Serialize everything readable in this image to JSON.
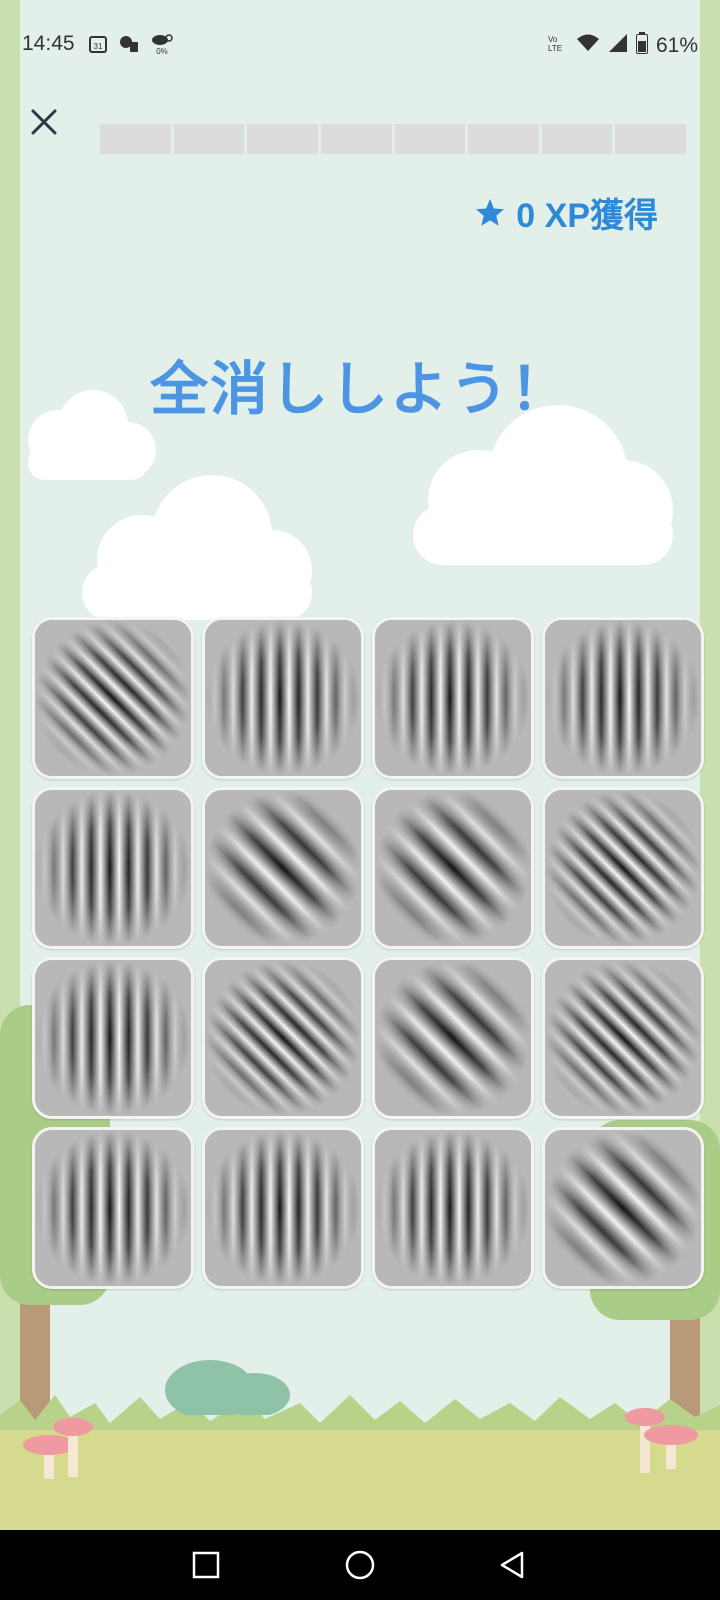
{
  "status_bar": {
    "time": "14:45",
    "battery_text": "61%",
    "left_icons": [
      "calendar-icon",
      "lock-icon",
      "weather-icon"
    ],
    "right_icons": [
      "volte-icon",
      "wifi-icon",
      "signal-icon",
      "battery-icon"
    ],
    "weather_percent": "0%",
    "calendar_day": "31",
    "volte_top": "Vo",
    "volte_bottom": "LTE"
  },
  "header": {
    "close_icon": "close-icon",
    "progress_segments": 8,
    "progress_filled": 0,
    "xp_value": "0 XP獲得",
    "xp_icon": "star-icon"
  },
  "title": "全消ししよう！",
  "grid": {
    "columns": 4,
    "rows": 4,
    "cards": [
      {
        "pattern": "diagonal-fine"
      },
      {
        "pattern": "vertical"
      },
      {
        "pattern": "vertical"
      },
      {
        "pattern": "vertical"
      },
      {
        "pattern": "vertical"
      },
      {
        "pattern": "diagonal-coarse"
      },
      {
        "pattern": "diagonal-coarse"
      },
      {
        "pattern": "diagonal-fine"
      },
      {
        "pattern": "vertical"
      },
      {
        "pattern": "diagonal-fine"
      },
      {
        "pattern": "diagonal-coarse"
      },
      {
        "pattern": "diagonal-fine"
      },
      {
        "pattern": "vertical"
      },
      {
        "pattern": "vertical"
      },
      {
        "pattern": "vertical"
      },
      {
        "pattern": "diagonal-coarse"
      }
    ]
  },
  "nav_bar": {
    "buttons": [
      "recents-icon",
      "home-icon",
      "back-icon"
    ]
  },
  "colors": {
    "accent": "#2e8ad6",
    "title": "#4b95e3",
    "background": "#e3efe9"
  }
}
